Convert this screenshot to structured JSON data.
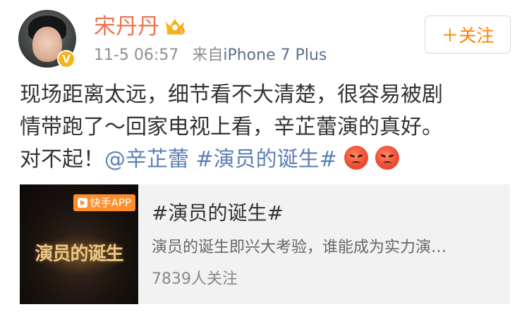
{
  "user": {
    "name": "宋丹丹",
    "avatar": "avatar",
    "verified_badge": "V",
    "crown_icon": "crown-icon"
  },
  "meta": {
    "time": "11-5 06:57",
    "source_prefix": "来自",
    "source": "iPhone 7 Plus"
  },
  "follow_button": {
    "label": "＋关注",
    "color": "#ff8200"
  },
  "post": {
    "line1": "现场距离太远，细节看不大清楚，很容易被剧",
    "line2": "情带跑了～回家电视上看，辛芷蕾演的真好。",
    "line3_text": "对不起！",
    "mention": "@辛芷蕾",
    "hashtag": "#演员的诞生#",
    "emoji": [
      "angry-icon",
      "angry-icon"
    ],
    "link_color": "#5d7fb5"
  },
  "card": {
    "thumb_badge": "快手APP",
    "thumb_logo": "演员的诞生",
    "title": "#演员的诞生#",
    "description": "演员的诞生即兴大考验，谁能成为实力演…",
    "followers": "7839人关注"
  }
}
